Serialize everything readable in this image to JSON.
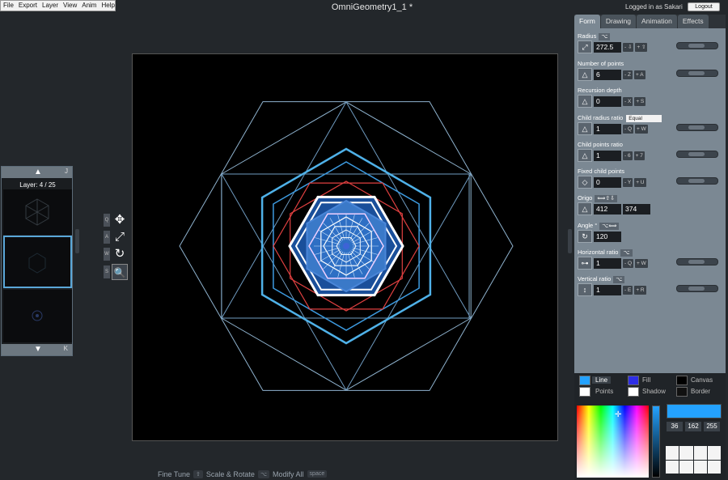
{
  "menu": [
    "File",
    "Export",
    "Layer",
    "View",
    "Anim",
    "Help"
  ],
  "title": "OmniGeometry1_1 *",
  "header": {
    "login_text": "Logged in as Sakari",
    "logout_label": "Logout"
  },
  "layers": {
    "up_arrow": "▲",
    "down_arrow": "▼",
    "up_key": "J",
    "down_key": "K",
    "label": "Layer: 4 / 25"
  },
  "tools": [
    {
      "key": "Q",
      "icon": "move-icon",
      "glyph": "✥"
    },
    {
      "key": "A",
      "icon": "expand-icon",
      "glyph": "⤢"
    },
    {
      "key": "W",
      "icon": "rotate-icon",
      "glyph": "↻"
    },
    {
      "key": "S",
      "icon": "zoom-icon",
      "glyph": "🔍"
    }
  ],
  "bottom": [
    {
      "label": "Fine Tune",
      "key": "⇧"
    },
    {
      "label": "Scale & Rotate",
      "key": "⌥"
    },
    {
      "label": "Modify All",
      "key": "space"
    }
  ],
  "tabs": [
    "Form",
    "Drawing",
    "Animation",
    "Effects"
  ],
  "form": {
    "radius": {
      "label": "Radius",
      "value": "272.5",
      "minus": "- ⇩",
      "plus": "+ ⇧"
    },
    "points": {
      "label": "Number of points",
      "value": "6",
      "minus": "- Z",
      "plus": "+ A"
    },
    "recursion": {
      "label": "Recursion depth",
      "value": "0",
      "minus": "- X",
      "plus": "+ S"
    },
    "child_radius": {
      "label": "Child radius ratio",
      "select": "Equal",
      "value": "1",
      "minus": "- Q",
      "plus": "+ W"
    },
    "child_points": {
      "label": "Child points ratio",
      "value": "1",
      "minus": "- 6",
      "plus": "+ 7"
    },
    "fixed_child": {
      "label": "Fixed child points",
      "value": "0",
      "minus": "- Y",
      "plus": "+ U"
    },
    "origin": {
      "label": "Origo",
      "x": "412",
      "y": "374"
    },
    "angle": {
      "label": "Angle °",
      "value": "120"
    },
    "horizontal": {
      "label": "Horizontal ratio",
      "value": "1",
      "minus": "- Q",
      "plus": "+ W"
    },
    "vertical": {
      "label": "Vertical ratio",
      "value": "1",
      "minus": "- E",
      "plus": "+ R"
    }
  },
  "colors": {
    "line_label": "Line",
    "points_label": "Points",
    "fill_label": "Fill",
    "shadow_label": "Shadow",
    "canvas_label": "Canvas",
    "border_label": "Border",
    "r": "36",
    "g": "162",
    "b": "255",
    "line_color": "#24a2ff",
    "fill_color": "#2e2ee6",
    "points_color": "#ffffff",
    "shadow_color": "#ffffff",
    "canvas_color": "#000000",
    "border_color": "#111111"
  }
}
